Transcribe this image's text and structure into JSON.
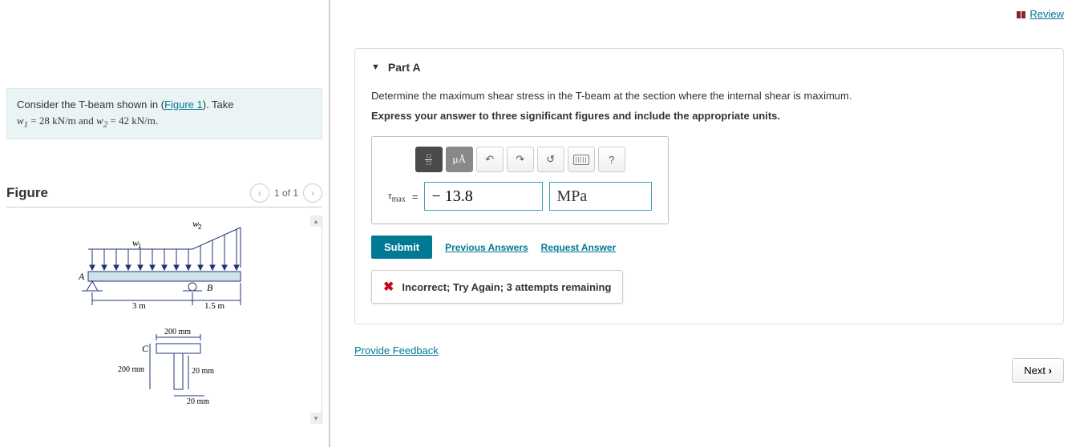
{
  "header": {
    "review": "Review"
  },
  "problem": {
    "prefix": "Consider the T-beam shown in (",
    "figlink": "Figure 1",
    "suffix": "). Take",
    "line2_pre": "w",
    "line2_sub1": "1",
    "line2_eq": " = 28 kN/m and ",
    "line2_w2": "w",
    "line2_sub2": "2",
    "line2_end": " = 42 kN/m."
  },
  "figure": {
    "title": "Figure",
    "pager": "1 of 1",
    "labels": {
      "w1": "w",
      "w1s": "1",
      "w2": "w",
      "w2s": "2",
      "A": "A",
      "B": "B",
      "span1": "3 m",
      "span2": "1.5 m",
      "flange": "200 mm",
      "height": "200 mm",
      "webw": "20 mm",
      "flanget": "20 mm",
      "C": "C"
    }
  },
  "part": {
    "title": "Part A",
    "prompt": "Determine the maximum shear stress in the T-beam at the section where the internal shear is maximum.",
    "instr": "Express your answer to three significant figures and include the appropriate units.",
    "var_html": "τ",
    "var_sub": "max",
    "eq": "=",
    "value": "− 13.8",
    "unit": "MPa",
    "toolbar": {
      "ua": "µÅ",
      "help": "?"
    },
    "submit": "Submit",
    "prev": "Previous Answers",
    "request": "Request Answer",
    "feedback": "Incorrect; Try Again; 3 attempts remaining"
  },
  "footer": {
    "provide": "Provide Feedback",
    "next": "Next"
  }
}
